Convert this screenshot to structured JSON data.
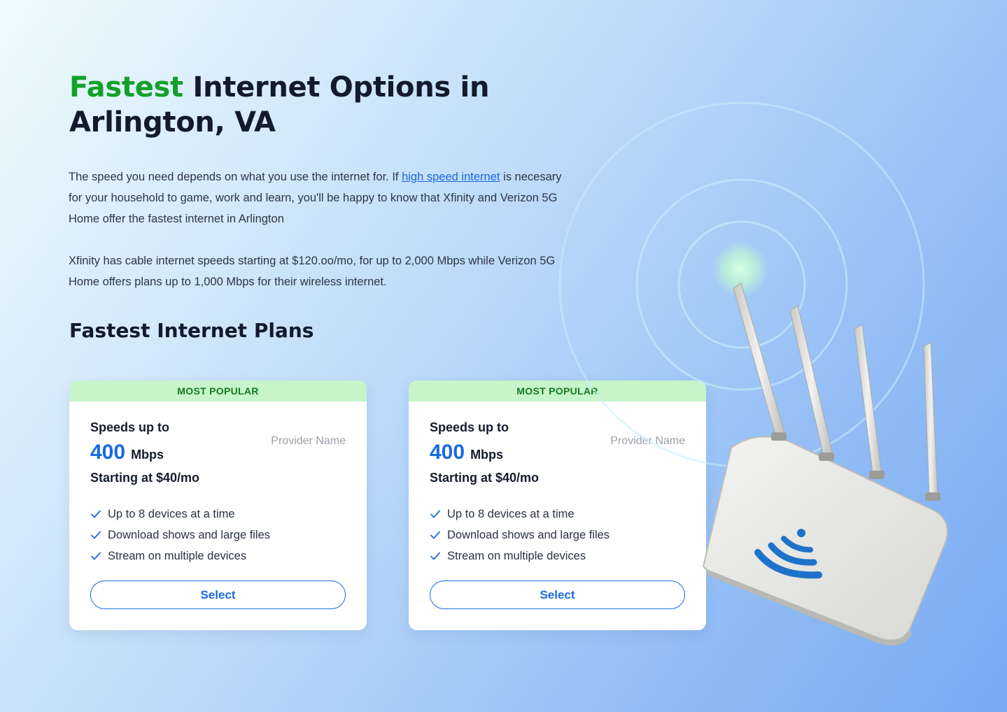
{
  "hero": {
    "title_accent": "Fastest",
    "title_rest": " Internet Options in Arlington, VA"
  },
  "intro": {
    "p1_before": "The speed you need depends on what you use the internet for. If ",
    "p1_link": "high speed internet",
    "p1_after": " is necesary for your household to game, work and learn, you'll be happy to know that Xfinity and Verizon 5G Home offer the fastest internet in Arlington",
    "p2": "Xfinity has cable internet speeds starting at $120.oo/mo, for up to 2,000 Mbps while Verizon 5G Home offers plans up to 1,000 Mbps for their wireless internet."
  },
  "plans_title": "Fastest Internet Plans",
  "plans": [
    {
      "badge": "MOST POPULAR",
      "speed_label": "Speeds up to",
      "speed_value": "400",
      "speed_unit": "Mbps",
      "price": "Starting at $40/mo",
      "provider": "Provider Name",
      "features": [
        "Up to 8 devices at a time",
        "Download shows and large files",
        "Stream on multiple devices"
      ],
      "button": "Select"
    },
    {
      "badge": "MOST POPULAR",
      "speed_label": "Speeds up to",
      "speed_value": "400",
      "speed_unit": "Mbps",
      "price": "Starting at $40/mo",
      "provider": "Provider Name",
      "features": [
        "Up to 8 devices at a time",
        "Download shows and large files",
        "Stream on multiple devices"
      ],
      "button": "Select"
    }
  ],
  "colors": {
    "accent_green": "#13a02a",
    "link_blue": "#1a6ae0",
    "badge_bg": "#c7f4c9",
    "badge_text": "#137a22"
  },
  "icons": [
    "check-icon",
    "wifi-router-illustration"
  ]
}
